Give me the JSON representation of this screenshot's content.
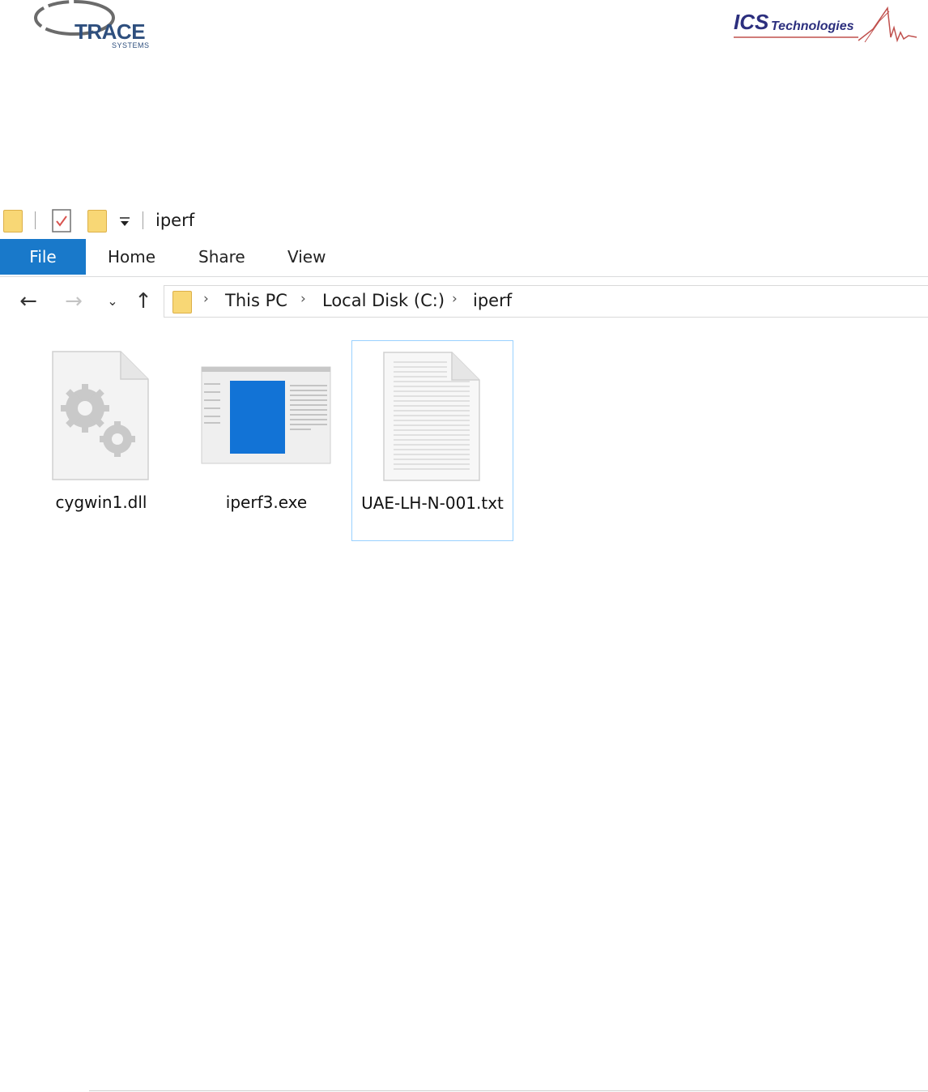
{
  "logos": {
    "trace": {
      "name": "TRACE",
      "sub": "SYSTEMS"
    },
    "ics": {
      "main": "ICS",
      "tech": "Technologies"
    }
  },
  "window": {
    "title": "iperf",
    "tabs": {
      "file": "File",
      "home": "Home",
      "share": "Share",
      "view": "View"
    },
    "breadcrumb": [
      "This PC",
      "Local Disk (C:)",
      "iperf"
    ]
  },
  "files": [
    {
      "name": "cygwin1.dll",
      "icon": "dll-gear-file-icon"
    },
    {
      "name": "iperf3.exe",
      "icon": "exe-window-thumbnail-icon"
    },
    {
      "name": "UAE-LH-N-001.txt",
      "icon": "text-document-icon",
      "selected": true
    }
  ],
  "colors": {
    "file_tab": "#1979ca",
    "selection_border": "#99d1ff",
    "folder": "#f8d775"
  }
}
